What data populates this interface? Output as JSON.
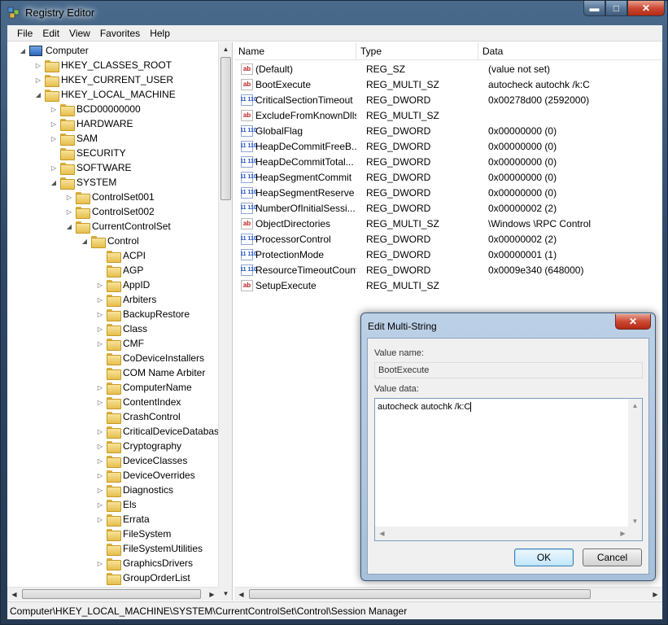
{
  "window": {
    "title": "Registry Editor",
    "minimize_label": "▬",
    "maximize_label": "□",
    "close_label": "✕"
  },
  "menu": [
    "File",
    "Edit",
    "View",
    "Favorites",
    "Help"
  ],
  "tree": [
    {
      "label": "Computer",
      "level": 0,
      "expander": "◢",
      "icon": "computer-icon"
    },
    {
      "label": "HKEY_CLASSES_ROOT",
      "level": 1,
      "expander": "▷",
      "icon": "folder-icon"
    },
    {
      "label": "HKEY_CURRENT_USER",
      "level": 1,
      "expander": "▷",
      "icon": "folder-icon"
    },
    {
      "label": "HKEY_LOCAL_MACHINE",
      "level": 1,
      "expander": "◢",
      "icon": "folder-icon"
    },
    {
      "label": "BCD00000000",
      "level": 2,
      "expander": "▷",
      "icon": "folder-icon"
    },
    {
      "label": "HARDWARE",
      "level": 2,
      "expander": "▷",
      "icon": "folder-icon"
    },
    {
      "label": "SAM",
      "level": 2,
      "expander": "▷",
      "icon": "folder-icon"
    },
    {
      "label": "SECURITY",
      "level": 2,
      "expander": "",
      "icon": "folder-icon"
    },
    {
      "label": "SOFTWARE",
      "level": 2,
      "expander": "▷",
      "icon": "folder-icon"
    },
    {
      "label": "SYSTEM",
      "level": 2,
      "expander": "◢",
      "icon": "folder-icon"
    },
    {
      "label": "ControlSet001",
      "level": 3,
      "expander": "▷",
      "icon": "folder-icon"
    },
    {
      "label": "ControlSet002",
      "level": 3,
      "expander": "▷",
      "icon": "folder-icon"
    },
    {
      "label": "CurrentControlSet",
      "level": 3,
      "expander": "◢",
      "icon": "folder-icon"
    },
    {
      "label": "Control",
      "level": 4,
      "expander": "◢",
      "icon": "folder-icon"
    },
    {
      "label": "ACPI",
      "level": 5,
      "expander": "",
      "icon": "folder-icon"
    },
    {
      "label": "AGP",
      "level": 5,
      "expander": "",
      "icon": "folder-icon"
    },
    {
      "label": "AppID",
      "level": 5,
      "expander": "▷",
      "icon": "folder-icon"
    },
    {
      "label": "Arbiters",
      "level": 5,
      "expander": "▷",
      "icon": "folder-icon"
    },
    {
      "label": "BackupRestore",
      "level": 5,
      "expander": "▷",
      "icon": "folder-icon"
    },
    {
      "label": "Class",
      "level": 5,
      "expander": "▷",
      "icon": "folder-icon"
    },
    {
      "label": "CMF",
      "level": 5,
      "expander": "▷",
      "icon": "folder-icon"
    },
    {
      "label": "CoDeviceInstallers",
      "level": 5,
      "expander": "",
      "icon": "folder-icon"
    },
    {
      "label": "COM Name Arbiter",
      "level": 5,
      "expander": "",
      "icon": "folder-icon"
    },
    {
      "label": "ComputerName",
      "level": 5,
      "expander": "▷",
      "icon": "folder-icon"
    },
    {
      "label": "ContentIndex",
      "level": 5,
      "expander": "▷",
      "icon": "folder-icon"
    },
    {
      "label": "CrashControl",
      "level": 5,
      "expander": "",
      "icon": "folder-icon"
    },
    {
      "label": "CriticalDeviceDatabas",
      "level": 5,
      "expander": "▷",
      "icon": "folder-icon"
    },
    {
      "label": "Cryptography",
      "level": 5,
      "expander": "▷",
      "icon": "folder-icon"
    },
    {
      "label": "DeviceClasses",
      "level": 5,
      "expander": "▷",
      "icon": "folder-icon"
    },
    {
      "label": "DeviceOverrides",
      "level": 5,
      "expander": "▷",
      "icon": "folder-icon"
    },
    {
      "label": "Diagnostics",
      "level": 5,
      "expander": "▷",
      "icon": "folder-icon"
    },
    {
      "label": "Els",
      "level": 5,
      "expander": "▷",
      "icon": "folder-icon"
    },
    {
      "label": "Errata",
      "level": 5,
      "expander": "▷",
      "icon": "folder-icon"
    },
    {
      "label": "FileSystem",
      "level": 5,
      "expander": "",
      "icon": "folder-icon"
    },
    {
      "label": "FileSystemUtilities",
      "level": 5,
      "expander": "",
      "icon": "folder-icon"
    },
    {
      "label": "GraphicsDrivers",
      "level": 5,
      "expander": "▷",
      "icon": "folder-icon"
    },
    {
      "label": "GroupOrderList",
      "level": 5,
      "expander": "",
      "icon": "folder-icon"
    }
  ],
  "list": {
    "columns": [
      "Name",
      "Type",
      "Data"
    ],
    "rows": [
      {
        "name": "(Default)",
        "type": "REG_SZ",
        "data": "(value not set)",
        "icon": "string-value-icon"
      },
      {
        "name": "BootExecute",
        "type": "REG_MULTI_SZ",
        "data": "autocheck autochk /k:C",
        "icon": "string-value-icon"
      },
      {
        "name": "CriticalSectionTimeout",
        "type": "REG_DWORD",
        "data": "0x00278d00 (2592000)",
        "icon": "binary-value-icon"
      },
      {
        "name": "ExcludeFromKnownDlls",
        "type": "REG_MULTI_SZ",
        "data": "",
        "icon": "string-value-icon"
      },
      {
        "name": "GlobalFlag",
        "type": "REG_DWORD",
        "data": "0x00000000 (0)",
        "icon": "binary-value-icon"
      },
      {
        "name": "HeapDeCommitFreeB...",
        "type": "REG_DWORD",
        "data": "0x00000000 (0)",
        "icon": "binary-value-icon"
      },
      {
        "name": "HeapDeCommitTotal...",
        "type": "REG_DWORD",
        "data": "0x00000000 (0)",
        "icon": "binary-value-icon"
      },
      {
        "name": "HeapSegmentCommit",
        "type": "REG_DWORD",
        "data": "0x00000000 (0)",
        "icon": "binary-value-icon"
      },
      {
        "name": "HeapSegmentReserve",
        "type": "REG_DWORD",
        "data": "0x00000000 (0)",
        "icon": "binary-value-icon"
      },
      {
        "name": "NumberOfInitialSessi...",
        "type": "REG_DWORD",
        "data": "0x00000002 (2)",
        "icon": "binary-value-icon"
      },
      {
        "name": "ObjectDirectories",
        "type": "REG_MULTI_SZ",
        "data": "\\Windows \\RPC Control",
        "icon": "string-value-icon"
      },
      {
        "name": "ProcessorControl",
        "type": "REG_DWORD",
        "data": "0x00000002 (2)",
        "icon": "binary-value-icon"
      },
      {
        "name": "ProtectionMode",
        "type": "REG_DWORD",
        "data": "0x00000001 (1)",
        "icon": "binary-value-icon"
      },
      {
        "name": "ResourceTimeoutCount",
        "type": "REG_DWORD",
        "data": "0x0009e340 (648000)",
        "icon": "binary-value-icon"
      },
      {
        "name": "SetupExecute",
        "type": "REG_MULTI_SZ",
        "data": "",
        "icon": "string-value-icon"
      }
    ]
  },
  "status": {
    "path": "Computer\\HKEY_LOCAL_MACHINE\\SYSTEM\\CurrentControlSet\\Control\\Session Manager"
  },
  "dialog": {
    "title": "Edit Multi-String",
    "close_label": "✕",
    "value_name_label": "Value name:",
    "value_name": "BootExecute",
    "value_data_label": "Value data:",
    "value_data": "autocheck autochk /k:C",
    "ok_label": "OK",
    "cancel_label": "Cancel"
  },
  "colors": {
    "frame": "#2f4866",
    "string_icon": "#c0211e",
    "dword_icon": "#1e4fbf",
    "default_button_border": "#3c7fb1"
  }
}
